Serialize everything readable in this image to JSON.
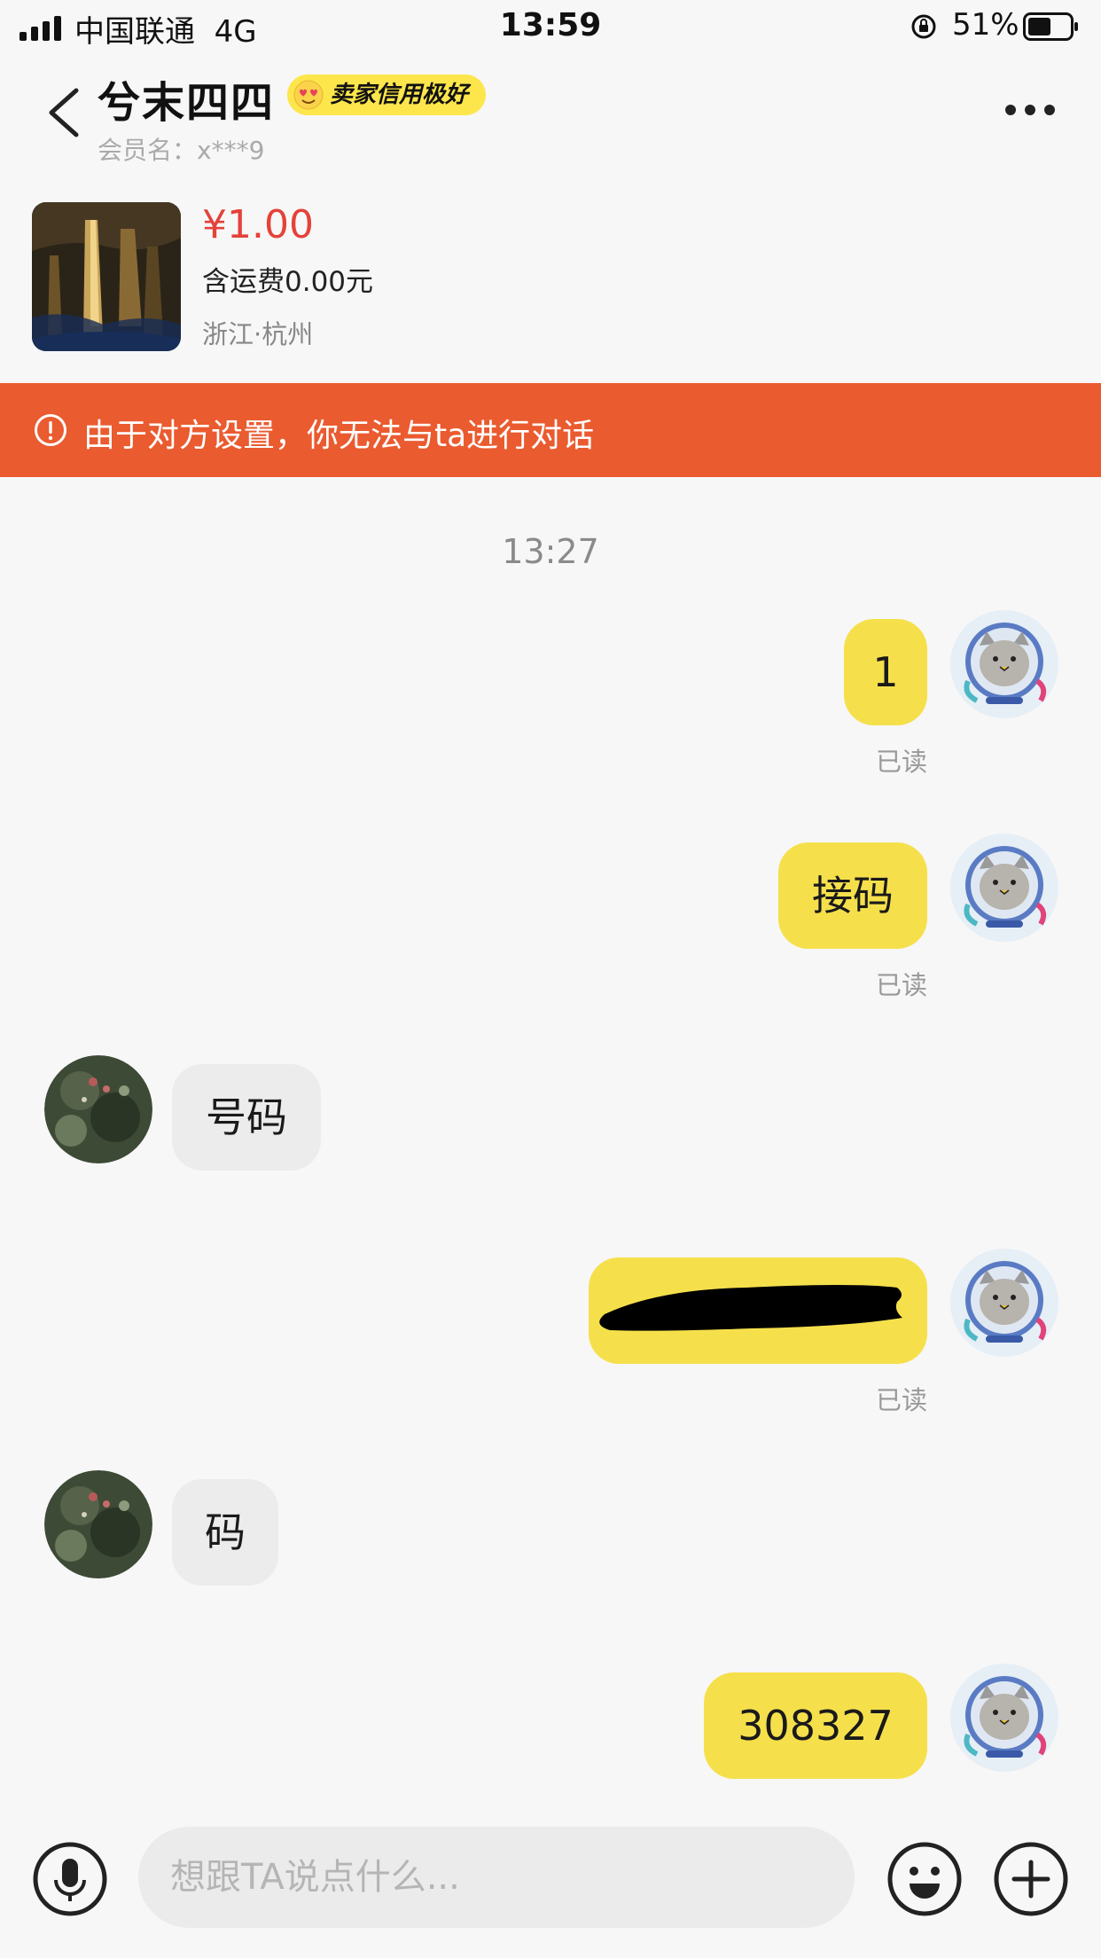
{
  "status_bar": {
    "carrier": "中国联通",
    "network": "4G",
    "time": "13:59",
    "battery_percent": "51%"
  },
  "header": {
    "name": "兮末四四",
    "badge": "卖家信用极好",
    "member_label": "会员名：",
    "member_name": "x***9"
  },
  "product": {
    "price": "¥1.00",
    "shipping": "含运费0.00元",
    "location": "浙江·杭州"
  },
  "warning": {
    "text": "由于对方设置，你无法与ta进行对话",
    "color": "#ea5b2f"
  },
  "chat": {
    "timestamp": "13:27",
    "messages": [
      {
        "from": "me",
        "text": "1",
        "read": "已读"
      },
      {
        "from": "me",
        "text": "接码",
        "read": "已读"
      },
      {
        "from": "them",
        "text": "号码"
      },
      {
        "from": "me",
        "text": "",
        "redacted": true,
        "read": "已读"
      },
      {
        "from": "them",
        "text": "码"
      },
      {
        "from": "me",
        "text": "308327"
      }
    ]
  },
  "input": {
    "placeholder": "想跟TA说点什么..."
  },
  "colors": {
    "my_bubble": "#f5e04c",
    "their_bubble": "#ececec",
    "price": "#e4423a"
  }
}
